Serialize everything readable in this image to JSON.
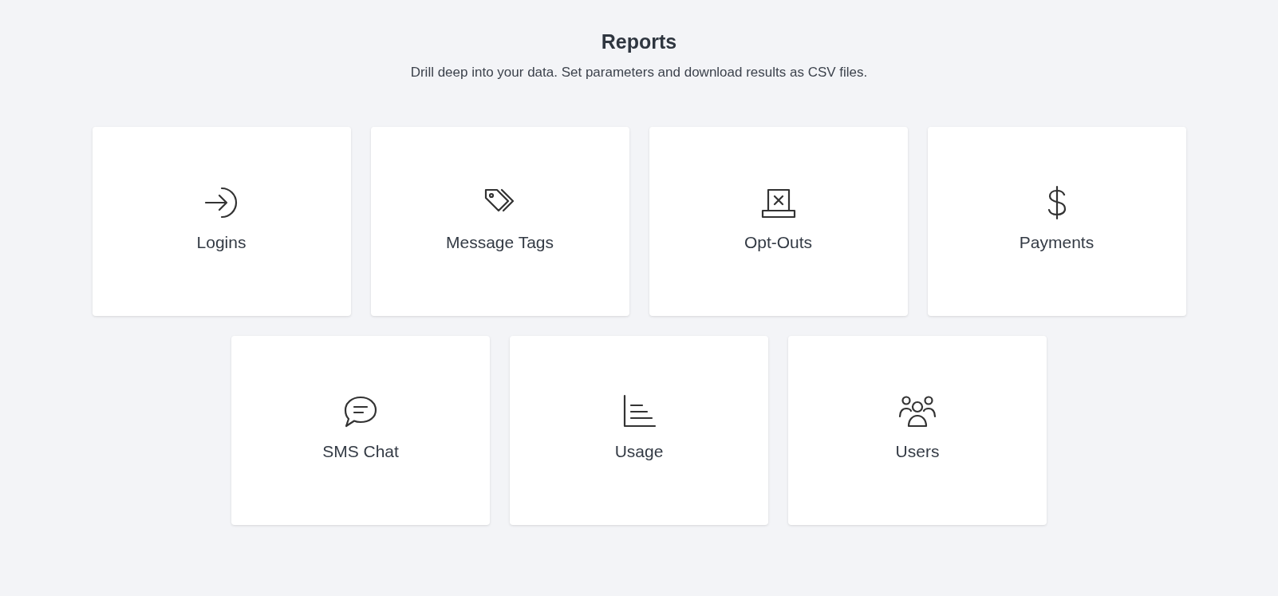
{
  "header": {
    "title": "Reports",
    "subtitle": "Drill deep into your data. Set parameters and download results as CSV files."
  },
  "reports": [
    {
      "label": "Logins",
      "kind": "login"
    },
    {
      "label": "Message Tags",
      "kind": "tags"
    },
    {
      "label": "Opt-Outs",
      "kind": "optout"
    },
    {
      "label": "Payments",
      "kind": "dollar"
    },
    {
      "label": "SMS Chat",
      "kind": "chat"
    },
    {
      "label": "Usage",
      "kind": "usage"
    },
    {
      "label": "Users",
      "kind": "users"
    }
  ]
}
